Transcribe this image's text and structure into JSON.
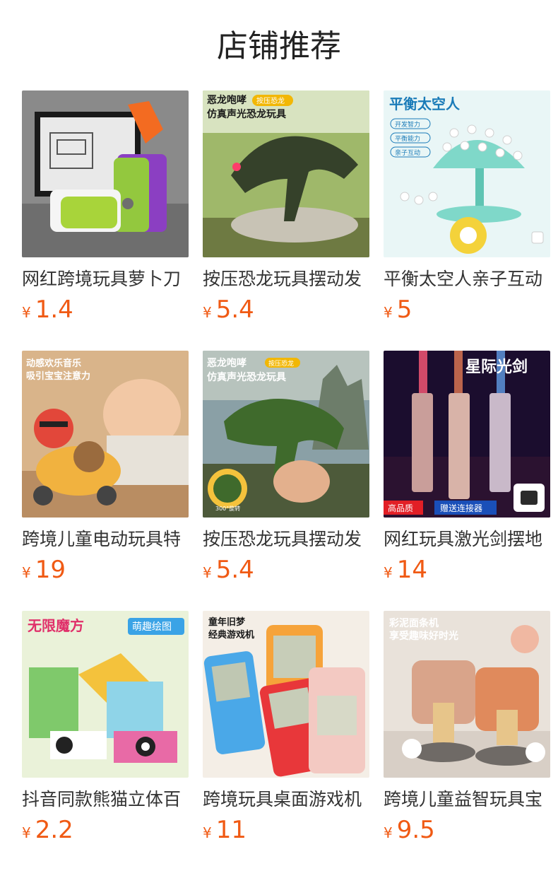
{
  "section": {
    "title": "店铺推荐"
  },
  "currency_symbol": "¥",
  "products": [
    {
      "name": "网红跨境玩具萝卜刀",
      "price": "1.4",
      "image_icon": "carrot-knife-toy-image",
      "overlay": {}
    },
    {
      "name": "按压恐龙玩具摆动发",
      "price": "5.4",
      "image_icon": "dinosaur-toy-image",
      "overlay": {
        "line1": "恶龙咆哮",
        "tag": "按压恐龙",
        "line2": "仿真声光恐龙玩具"
      }
    },
    {
      "name": "平衡太空人亲子互动",
      "price": "5",
      "image_icon": "balance-astronaut-toy-image",
      "overlay": {
        "line1": "平衡太空人",
        "tags": [
          "开发智力",
          "平衡能力",
          "亲子互动"
        ]
      }
    },
    {
      "name": "跨境儿童电动玩具特",
      "price": "19",
      "image_icon": "electric-scooter-toy-image",
      "overlay": {
        "line1": "动感欢乐音乐",
        "line2": "吸引宝宝注意力"
      }
    },
    {
      "name": "按压恐龙玩具摆动发",
      "price": "5.4",
      "image_icon": "dinosaur-press-toy-image",
      "overlay": {
        "line1": "恶龙咆哮",
        "tag": "按压恐龙",
        "line2": "仿真声光恐龙玩具",
        "badge": "300°旋转"
      }
    },
    {
      "name": "网红玩具激光剑摆地",
      "price": "14",
      "image_icon": "light-saber-toy-image",
      "overlay": {
        "line1": "星际光剑",
        "tag": "高品质",
        "tag2": "赠送连接器"
      }
    },
    {
      "name": "抖音同款熊猫立体百",
      "price": "2.2",
      "image_icon": "panda-magic-cube-image",
      "overlay": {
        "line1": "无限魔方",
        "tag": "萌趣绘图"
      }
    },
    {
      "name": "跨境玩具桌面游戏机",
      "price": "11",
      "image_icon": "handheld-game-console-image",
      "overlay": {
        "line1": "童年旧梦",
        "line2": "经典游戏机"
      }
    },
    {
      "name": "跨境儿童益智玩具宝",
      "price": "9.5",
      "image_icon": "noodle-machine-toy-image",
      "overlay": {
        "line1": "彩泥面条机",
        "line2": "享受趣味好时光"
      }
    }
  ]
}
